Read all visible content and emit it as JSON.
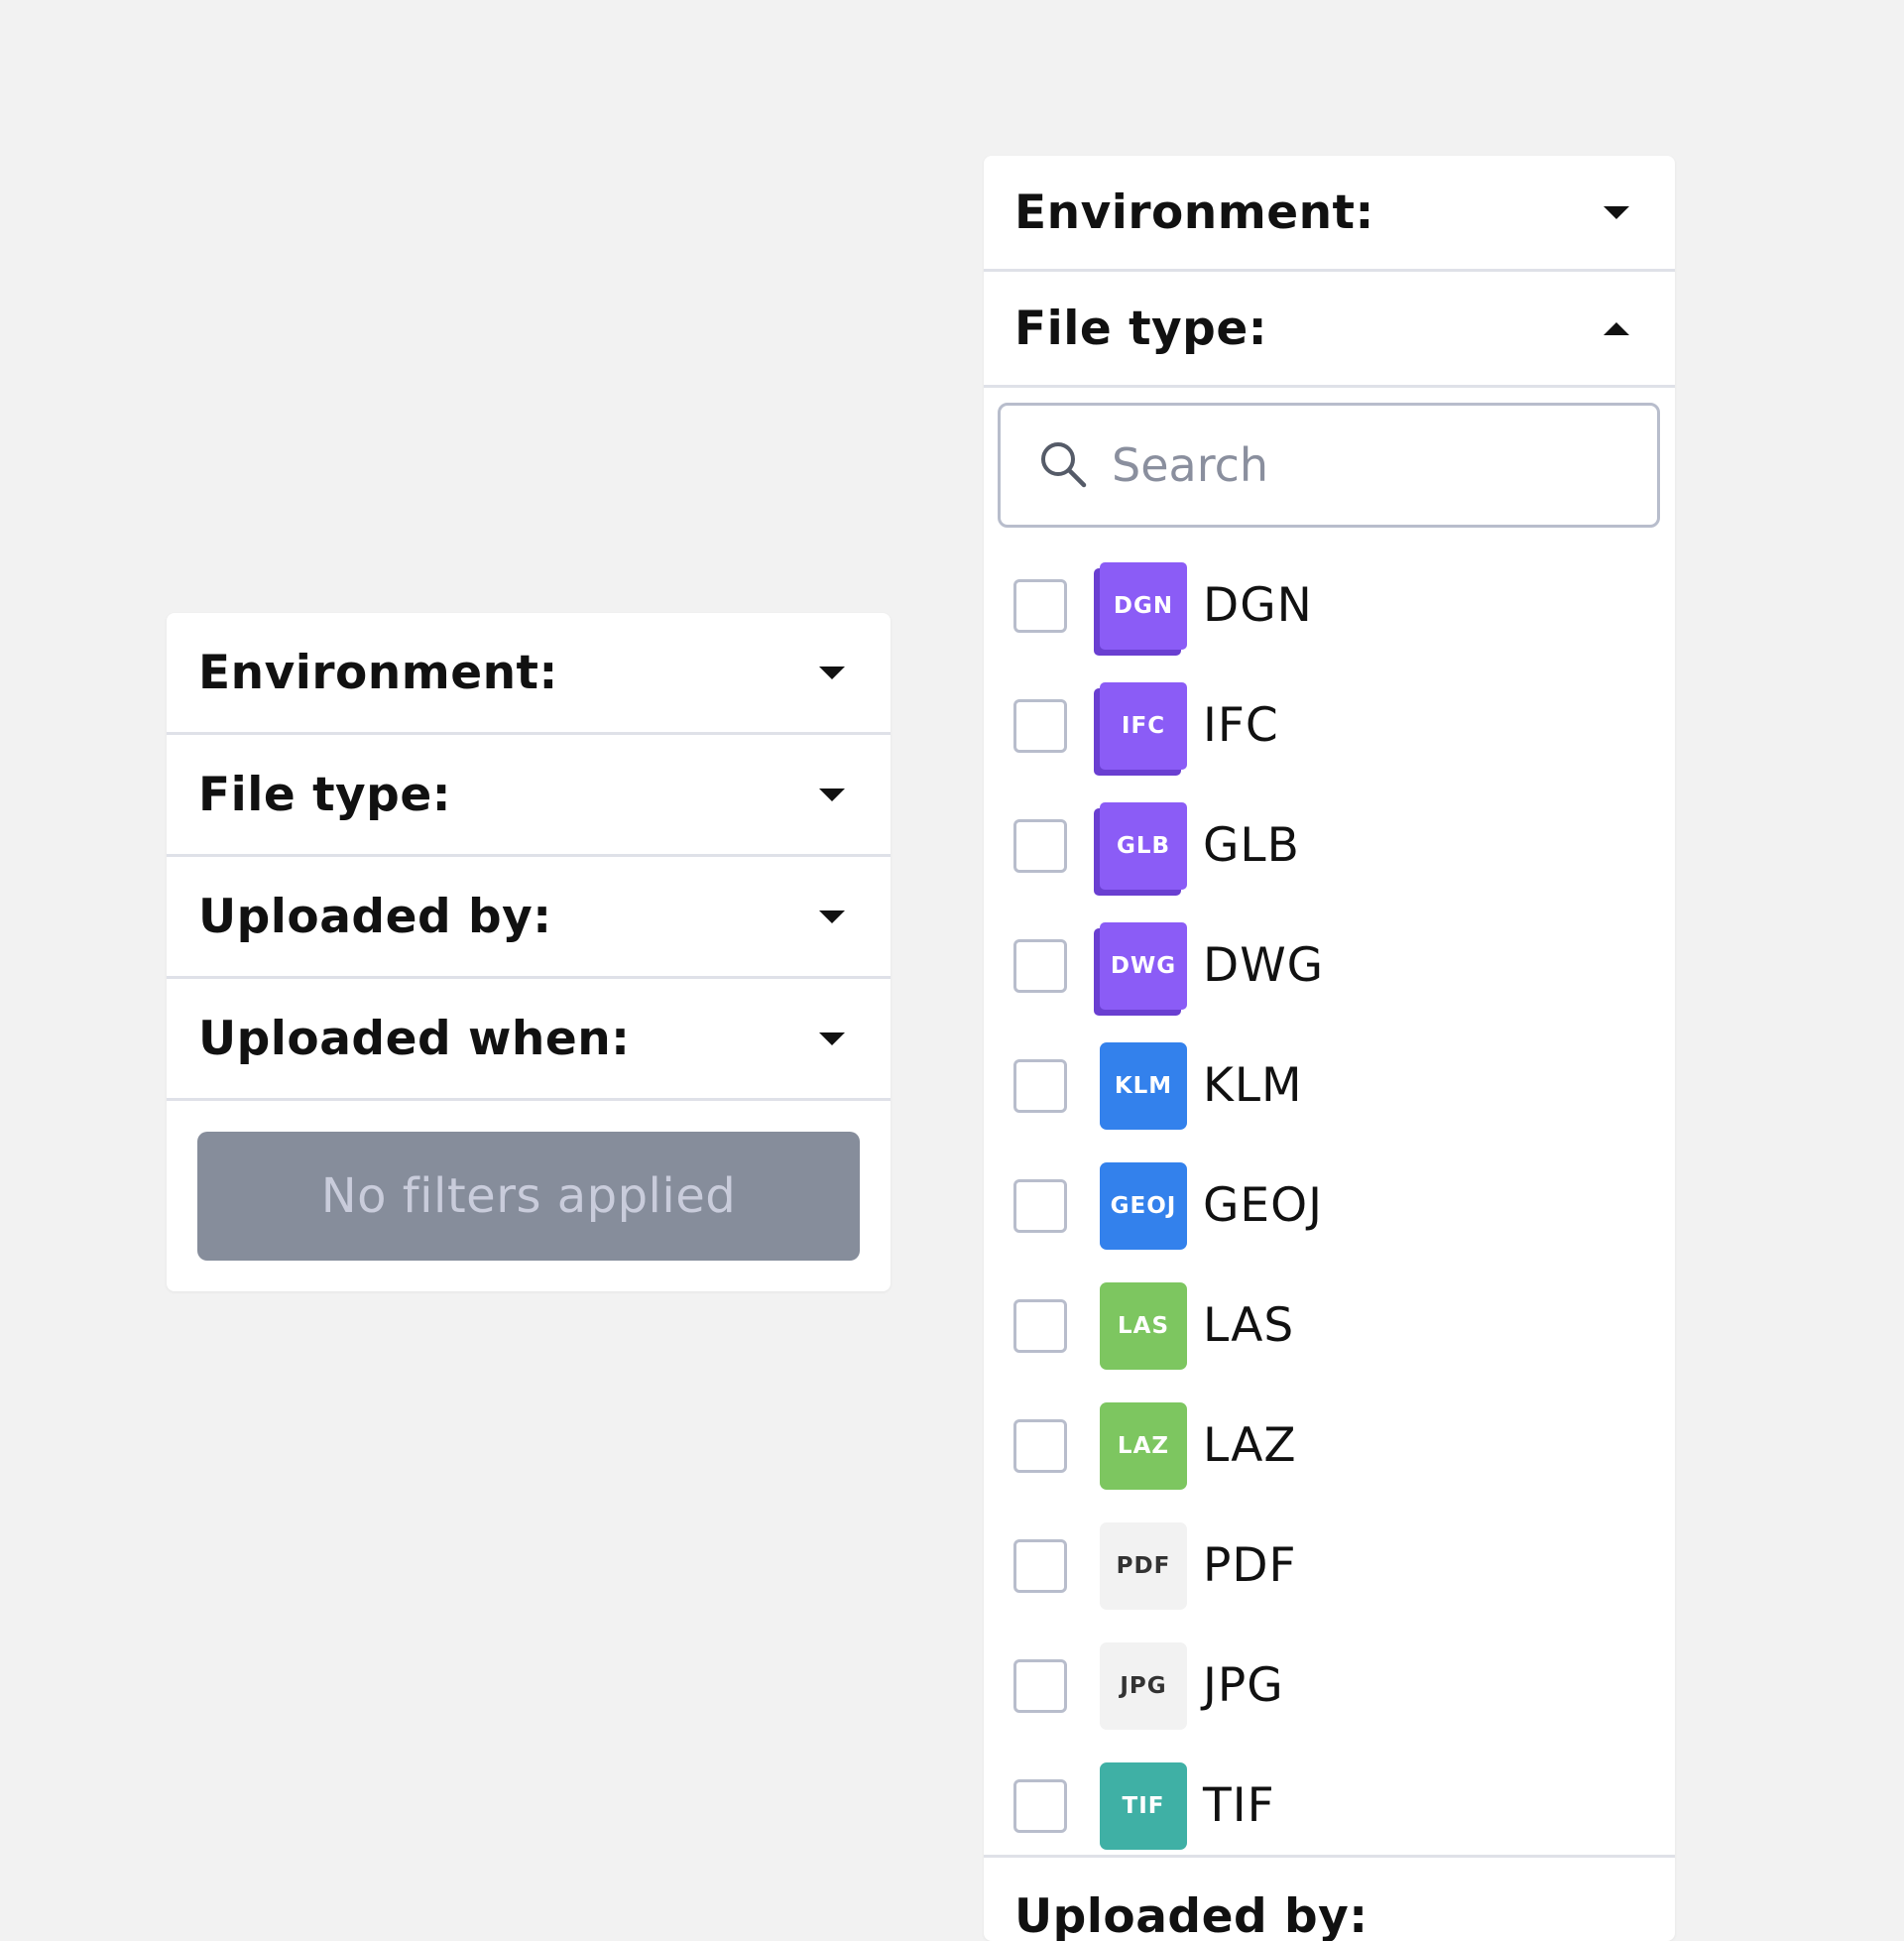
{
  "left_panel": {
    "filters": [
      {
        "label": "Environment:"
      },
      {
        "label": "File type:"
      },
      {
        "label": "Uploaded by:"
      },
      {
        "label": "Uploaded when:"
      }
    ],
    "status_button": "No filters applied"
  },
  "right_panel": {
    "filters": [
      {
        "label": "Environment:",
        "state": "collapsed"
      },
      {
        "label": "File type:",
        "state": "expanded"
      }
    ],
    "search": {
      "placeholder": "Search",
      "value": "",
      "icon": "search-icon"
    },
    "file_types": [
      {
        "name": "DGN",
        "badge": "DGN",
        "color": "#8b5cf6",
        "style": "cube",
        "checked": false
      },
      {
        "name": "IFC",
        "badge": "IFC",
        "color": "#8b5cf6",
        "style": "cube",
        "checked": false
      },
      {
        "name": "GLB",
        "badge": "GLB",
        "color": "#8b5cf6",
        "style": "cube",
        "checked": false
      },
      {
        "name": "DWG",
        "badge": "DWG",
        "color": "#8b5cf6",
        "style": "cube",
        "checked": false
      },
      {
        "name": "KLM",
        "badge": "KLM",
        "color": "#3381ec",
        "style": "flat",
        "checked": false
      },
      {
        "name": "GEOJ",
        "badge": "GEOJ",
        "color": "#3381ec",
        "style": "flat",
        "checked": false
      },
      {
        "name": "LAS",
        "badge": "LAS",
        "color": "#7dc660",
        "style": "flat",
        "checked": false
      },
      {
        "name": "LAZ",
        "badge": "LAZ",
        "color": "#7dc660",
        "style": "flat",
        "checked": false
      },
      {
        "name": "PDF",
        "badge": "PDF",
        "color": "#f2f2f2",
        "text_color": "#333333",
        "style": "flat",
        "checked": false
      },
      {
        "name": "JPG",
        "badge": "JPG",
        "color": "#f2f2f2",
        "text_color": "#333333",
        "style": "flat",
        "checked": false
      },
      {
        "name": "TIF",
        "badge": "TIF",
        "color": "#3fb0a5",
        "style": "flat",
        "checked": false
      }
    ],
    "next_filter_label": "Uploaded by:"
  }
}
